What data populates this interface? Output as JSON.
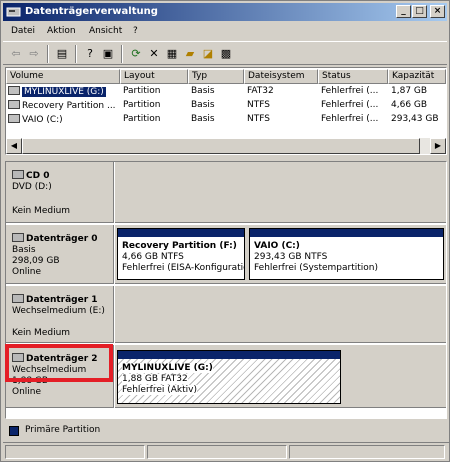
{
  "window": {
    "title": "Datenträgerverwaltung",
    "controls": {
      "minimize": "_",
      "maximize": "□",
      "close": "×"
    }
  },
  "menu": [
    "Datei",
    "Aktion",
    "Ansicht",
    "?"
  ],
  "toolbar": [
    "back-icon",
    "forward-icon",
    "properties-view-icon",
    "help-icon",
    "console-icon",
    "refresh-icon",
    "delete-icon",
    "properties-icon",
    "open-icon",
    "explore-icon",
    "settings-icon"
  ],
  "volume_list": {
    "columns": [
      "Volume",
      "Layout",
      "Typ",
      "Dateisystem",
      "Status",
      "Kapazität"
    ],
    "rows": [
      [
        "MYLINUXLIVE (G:)",
        "Partition",
        "Basis",
        "FAT32",
        "Fehlerfrei (...",
        "1,87 GB"
      ],
      [
        "Recovery Partition ...",
        "Partition",
        "Basis",
        "NTFS",
        "Fehlerfrei (...",
        "4,66 GB"
      ],
      [
        "VAIO (C:)",
        "Partition",
        "Basis",
        "NTFS",
        "Fehlerfrei (...",
        "293,43 GB"
      ]
    ]
  },
  "disks": [
    {
      "name": "CD 0",
      "lines": [
        "DVD (D:)",
        "",
        "Kein Medium"
      ],
      "partitions": []
    },
    {
      "name": "Datenträger 0",
      "lines": [
        "Basis",
        "298,09 GB",
        "Online"
      ],
      "partitions": [
        {
          "name": "Recovery Partition  (F:)",
          "size": "4,66 GB NTFS",
          "status": "Fehlerfrei (EISA-Konfiguratic"
        },
        {
          "name": "VAIO  (C:)",
          "size": "293,43 GB NTFS",
          "status": "Fehlerfrei (Systempartition)"
        }
      ]
    },
    {
      "name": "Datenträger 1",
      "lines": [
        "Wechselmedium (E:)",
        "",
        "Kein Medium"
      ],
      "partitions": []
    },
    {
      "name": "Datenträger 2",
      "lines": [
        "Wechselmedium",
        "1,88 GB",
        "Online"
      ],
      "partitions": [
        {
          "name": "MYLINUXLIVE  (G:)",
          "size": "1,88 GB FAT32",
          "status": "Fehlerfrei (Aktiv)"
        }
      ]
    }
  ],
  "legend": {
    "label": "Primäre Partition",
    "color": "#0a246a"
  },
  "colors": {
    "title_bar": "#0a246a",
    "highlight": "#e41e26",
    "selection": "#0a246a"
  }
}
